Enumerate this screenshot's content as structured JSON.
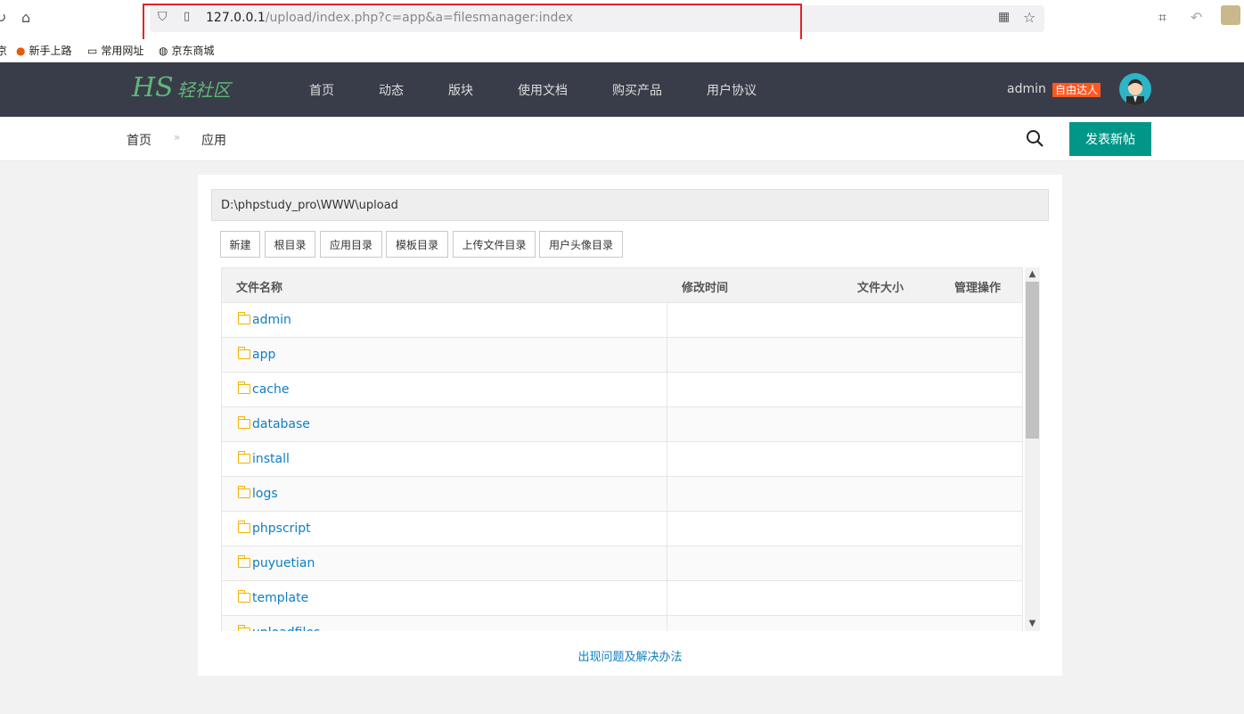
{
  "browser": {
    "url_host": "127.0.0.1",
    "url_path": "/upload/index.php?c=app&a=filesmanager:index",
    "bookmarks": [
      "新手上路",
      "常用网址",
      "京东商城"
    ],
    "leftover_bookmark": "京"
  },
  "header": {
    "logo_text": "HS",
    "logo_cn": "轻社区",
    "nav": [
      "首页",
      "动态",
      "版块",
      "使用文档",
      "购买产品",
      "用户协议"
    ],
    "username": "admin",
    "badge": "自由达人"
  },
  "breadcrumb": {
    "home": "首页",
    "separator": "»",
    "current": "应用",
    "new_post_label": "发表新帖"
  },
  "filemanager": {
    "path": "D:\\phpstudy_pro\\WWW\\upload",
    "buttons": [
      "新建",
      "根目录",
      "应用目录",
      "模板目录",
      "上传文件目录",
      "用户头像目录"
    ],
    "columns": {
      "name": "文件名称",
      "modified": "修改时间",
      "size": "文件大小",
      "actions": "管理操作"
    },
    "folders": [
      "admin",
      "app",
      "cache",
      "database",
      "install",
      "logs",
      "phpscript",
      "puyuetian",
      "template",
      "uploadfiles"
    ],
    "help_link": "出现问题及解决办法"
  },
  "colors": {
    "header_bg": "#393d49",
    "accent_green": "#009688",
    "link_blue": "#0f7ec0",
    "badge_orange": "#ff5722",
    "highlight_red": "#e02424"
  }
}
